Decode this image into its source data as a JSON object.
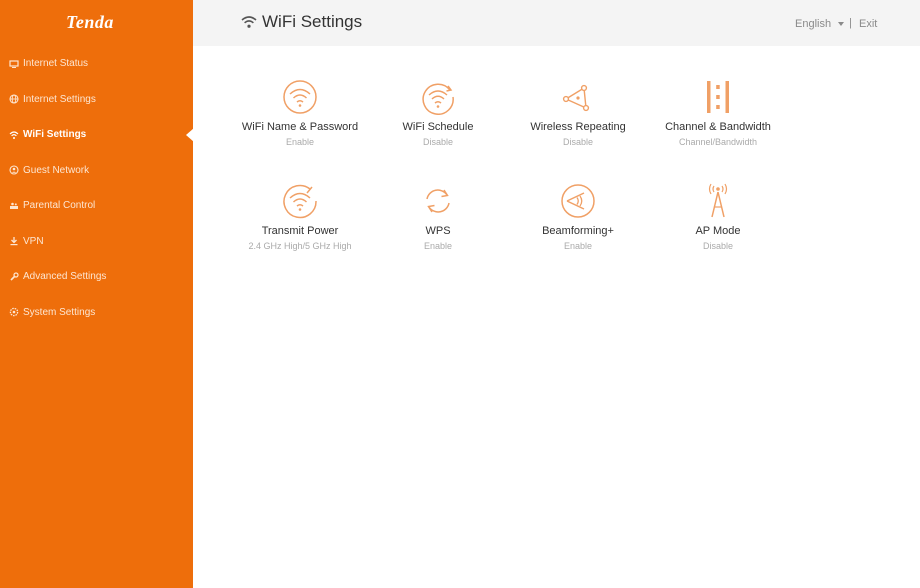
{
  "brand": {
    "logo": "Tenda",
    "accent": "#ee6e0b",
    "icon_color": "#f0a066"
  },
  "sidebar": {
    "items": [
      {
        "label": "Internet Status",
        "icon": "monitor-icon",
        "active": false
      },
      {
        "label": "Internet Settings",
        "icon": "globe-icon",
        "active": false
      },
      {
        "label": "WiFi Settings",
        "icon": "wifi-icon",
        "active": true
      },
      {
        "label": "Guest Network",
        "icon": "guest-icon",
        "active": false
      },
      {
        "label": "Parental Control",
        "icon": "parental-icon",
        "active": false
      },
      {
        "label": "VPN",
        "icon": "vpn-icon",
        "active": false
      },
      {
        "label": "Advanced Settings",
        "icon": "wrench-icon",
        "active": false
      },
      {
        "label": "System Settings",
        "icon": "gear-icon",
        "active": false
      }
    ]
  },
  "header": {
    "title": "WiFi Settings",
    "language": "English",
    "separator": "|",
    "exit_label": "Exit"
  },
  "settings": [
    {
      "name": "WiFi Name & Password",
      "status": "Enable",
      "icon": "wifi-circle-icon"
    },
    {
      "name": "WiFi Schedule",
      "status": "Disable",
      "icon": "wifi-schedule-icon"
    },
    {
      "name": "Wireless Repeating",
      "status": "Disable",
      "icon": "repeater-icon"
    },
    {
      "name": "Channel & Bandwidth",
      "status": "Channel/Bandwidth",
      "icon": "channel-bars-icon"
    },
    {
      "name": "Transmit Power",
      "status": "2.4 GHz High/5 GHz High",
      "icon": "transmit-power-icon"
    },
    {
      "name": "WPS",
      "status": "Enable",
      "icon": "wps-refresh-icon"
    },
    {
      "name": "Beamforming+",
      "status": "Enable",
      "icon": "beamforming-icon"
    },
    {
      "name": "AP Mode",
      "status": "Disable",
      "icon": "antenna-icon"
    }
  ]
}
